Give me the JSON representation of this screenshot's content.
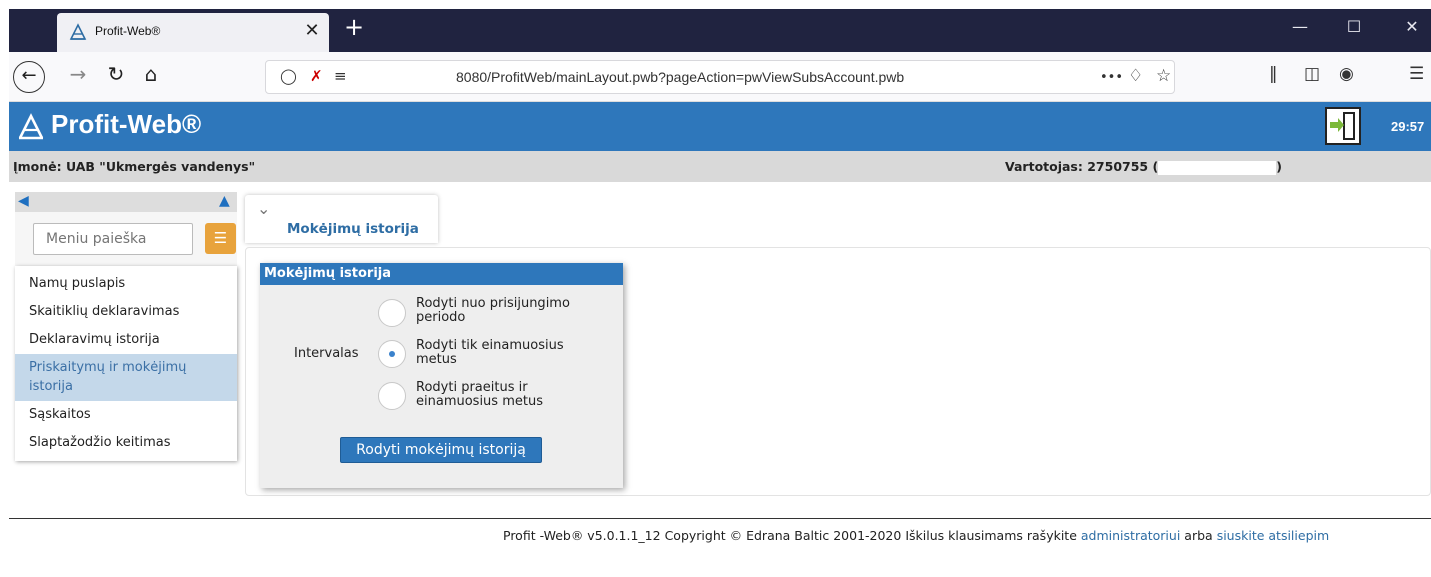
{
  "browser": {
    "tab_title": "Profit-Web®",
    "tab_close": "✕",
    "new_tab": "+",
    "url": "8080/ProfitWeb/mainLayout.pwb?pageAction=pwViewSubsAccount.pwb",
    "url_more": "•••",
    "window_controls": [
      "—",
      "☐",
      "✕"
    ]
  },
  "app": {
    "title": "Profit-Web®",
    "timer": "29:57",
    "company_label": "Įmonė: UAB \"Ukmergės vandenys\"",
    "user_label": "Vartotojas: 2750755 (",
    "user_close": ")"
  },
  "sidebar": {
    "search_placeholder": "Meniu paieška",
    "items": [
      {
        "label": "Namų puslapis"
      },
      {
        "label": "Skaitiklių deklaravimas"
      },
      {
        "label": "Deklaravimų istorija"
      },
      {
        "label": "Priskaitymų ir mokėjimų istorija",
        "active": true
      },
      {
        "label": "Sąskaitos"
      },
      {
        "label": "Slaptažodžio keitimas"
      }
    ]
  },
  "page": {
    "tab_title": "Mokėjimų istorija",
    "panel_title": "Mokėjimų istorija",
    "interval_label": "Intervalas",
    "options": [
      {
        "line1": "Rodyti nuo prisijungimo",
        "line2": "periodo",
        "selected": false
      },
      {
        "line1": "Rodyti tik einamuosius",
        "line2": "metus",
        "selected": true
      },
      {
        "line1": "Rodyti praeitus ir",
        "line2": "einamuosius metus",
        "selected": false
      }
    ],
    "submit_label": "Rodyti mokėjimų istoriją"
  },
  "footer": {
    "text": "Profit -Web® v5.0.1.1_12 Copyright © Edrana Baltic 2001-2020 Iškilus klausimams rašykite",
    "link1": "administratoriui",
    "middle": "arba",
    "link2": "siuskite atsiliepim"
  },
  "colors": {
    "brand": "#2e77bb",
    "menu_button": "#e8a33c",
    "active_item": "#c4d8ea"
  }
}
